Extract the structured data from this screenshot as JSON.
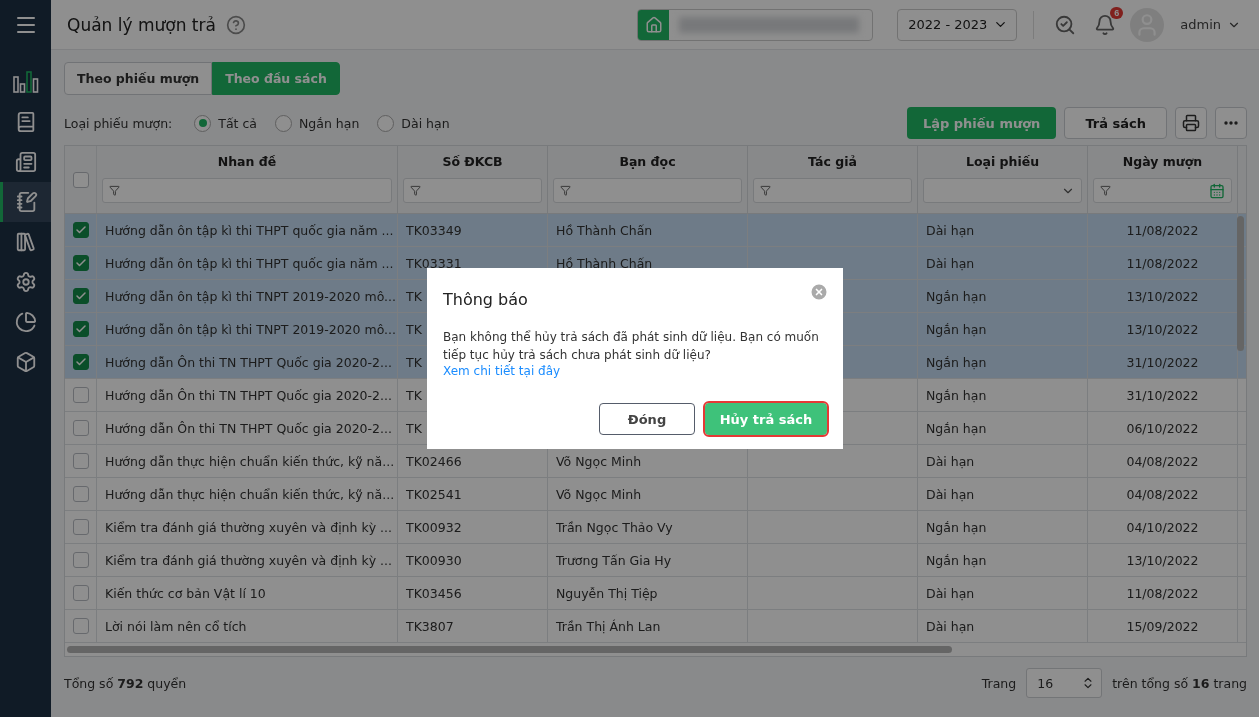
{
  "header": {
    "title": "Quản lý mượn trả",
    "year": "2022 - 2023",
    "notification_count": "6",
    "user": "admin"
  },
  "sidebar": {
    "items": [
      {
        "kind": "chart",
        "selected": false
      },
      {
        "kind": "book",
        "selected": false
      },
      {
        "kind": "news",
        "selected": false
      },
      {
        "kind": "borrow",
        "selected": true
      },
      {
        "kind": "reader",
        "selected": false
      },
      {
        "kind": "settings",
        "selected": false
      },
      {
        "kind": "report",
        "selected": false
      },
      {
        "kind": "package",
        "selected": false
      }
    ]
  },
  "view_tabs": [
    {
      "label": "Theo phiếu mượn",
      "selected": false
    },
    {
      "label": "Theo đầu sách",
      "selected": true
    }
  ],
  "filter": {
    "label": "Loại phiếu mượn:",
    "options": [
      {
        "label": "Tất cả",
        "selected": true
      },
      {
        "label": "Ngắn hạn",
        "selected": false
      },
      {
        "label": "Dài hạn",
        "selected": false
      }
    ]
  },
  "actions": {
    "primary": "Lập phiếu mượn",
    "secondary": "Trả sách"
  },
  "table": {
    "all_checked": false,
    "columns": [
      {
        "label": "Nhan đề",
        "kind": "text"
      },
      {
        "label": "Số ĐKCB",
        "kind": "text"
      },
      {
        "label": "Bạn đọc",
        "kind": "text"
      },
      {
        "label": "Tác giả",
        "kind": "text"
      },
      {
        "label": "Loại phiếu",
        "kind": "select"
      },
      {
        "label": "Ngày mượn",
        "kind": "date"
      }
    ],
    "rows": [
      {
        "checked": true,
        "title": "Hướng dẫn ôn tập kì thi THPT quốc gia năm ...",
        "code": "TK03349",
        "reader": "Hồ Thành Chấn",
        "type": "Dài hạn",
        "date": "11/08/2022"
      },
      {
        "checked": true,
        "title": "Hướng dẫn ôn tập kì thi THPT quốc gia năm ...",
        "code": "TK03331",
        "reader": "Hồ Thành Chấn",
        "type": "Dài hạn",
        "date": "11/08/2022"
      },
      {
        "checked": true,
        "title": "Hướng dẫn ôn tập kì thi TNPT 2019-2020 mô...",
        "code": "TK",
        "type": "Ngắn hạn",
        "date": "13/10/2022"
      },
      {
        "checked": true,
        "title": "Hướng dẫn ôn tập kì thi TNPT 2019-2020 mô...",
        "code": "TK",
        "type": "Ngắn hạn",
        "date": "13/10/2022"
      },
      {
        "checked": true,
        "title": "Hướng dẫn Ôn thi TN THPT Quốc gia 2020-2...",
        "code": "TK",
        "type": "Ngắn hạn",
        "date": "31/10/2022"
      },
      {
        "checked": false,
        "title": "Hướng dẫn Ôn thi TN THPT Quốc gia 2020-2...",
        "code": "TK",
        "type": "Ngắn hạn",
        "date": "31/10/2022"
      },
      {
        "checked": false,
        "title": "Hướng dẫn Ôn thi TN THPT Quốc gia 2020-2...",
        "code": "TK",
        "type": "Ngắn hạn",
        "date": "06/10/2022"
      },
      {
        "checked": false,
        "title": "Hướng dẫn thực hiện chuẩn kiến thức, kỹ nă...",
        "code": "TK02466",
        "reader": "Võ Ngọc Minh",
        "type": "Dài hạn",
        "date": "04/08/2022"
      },
      {
        "checked": false,
        "title": "Hướng dẫn thực hiện chuẩn kiến thức, kỹ nă...",
        "code": "TK02541",
        "reader": "Võ Ngọc Minh",
        "type": "Dài hạn",
        "date": "04/08/2022"
      },
      {
        "checked": false,
        "title": "Kiểm tra đánh giá thường xuyên và định kỳ ...",
        "code": "TK00932",
        "reader": "Trần Ngọc Thảo Vy",
        "type": "Ngắn hạn",
        "date": "04/10/2022"
      },
      {
        "checked": false,
        "title": "Kiểm tra đánh giá thường xuyên và định kỳ ...",
        "code": "TK00930",
        "reader": "Trương Tấn Gia Hy",
        "type": "Ngắn hạn",
        "date": "13/10/2022"
      },
      {
        "checked": false,
        "title": "Kiến thức cơ bản Vật lí 10",
        "code": "TK03456",
        "reader": "Nguyễn Thị Tiệp",
        "type": "Dài hạn",
        "date": "11/08/2022"
      },
      {
        "checked": false,
        "title": "Lời nói làm nên cổ tích",
        "code": "TK3807",
        "reader": "Trần Thị Ánh Lan",
        "type": "Dài hạn",
        "date": "15/09/2022"
      }
    ]
  },
  "footer": {
    "total": "Tổng số **792** quyển",
    "page_label": "Trang",
    "page": "16",
    "page_total": "trên tổng số **16** trang"
  },
  "dialog": {
    "title": "Thông báo",
    "message": "Bạn không thể hủy trả sách đã phát sinh dữ liệu. Bạn có muốn tiếp tục hủy trả sách chưa phát sinh dữ liệu?",
    "link": "Xem chi tiết tại đây",
    "buttons": [
      {
        "label": "Đóng",
        "kind": "secondary",
        "highlighted": false
      },
      {
        "label": "Hủy trả sách",
        "kind": "primary",
        "highlighted": true
      }
    ]
  }
}
